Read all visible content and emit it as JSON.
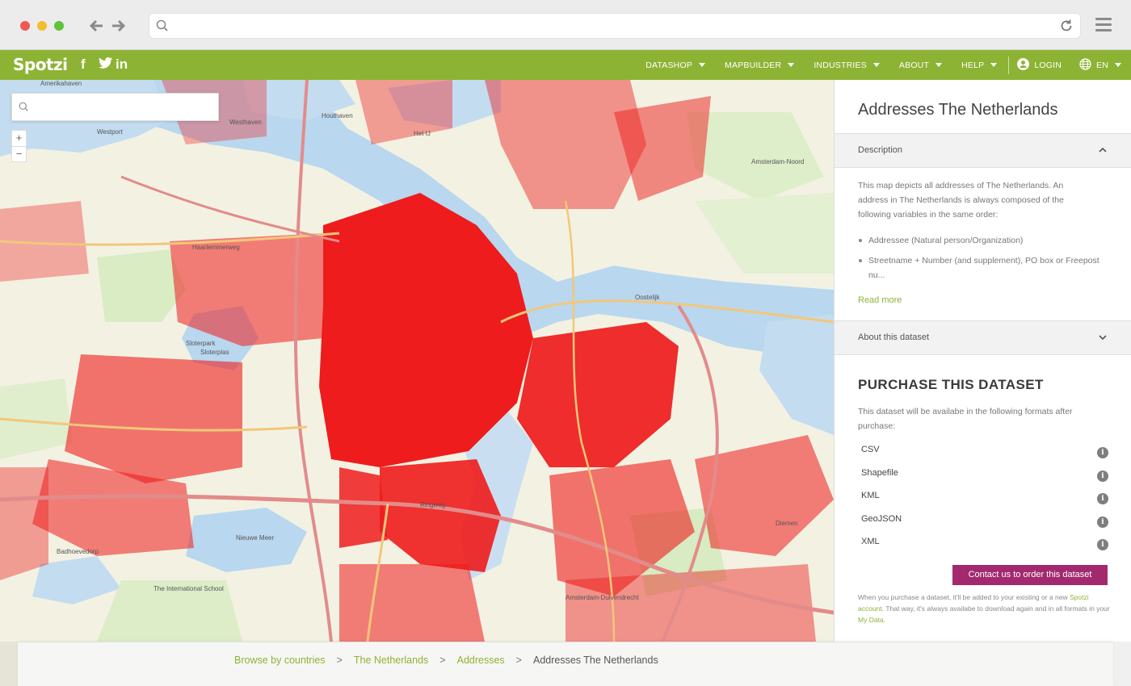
{
  "browser": {
    "back_icon": "arrow-left-icon",
    "forward_icon": "arrow-right-icon",
    "url": "",
    "reload_icon": "reload-icon",
    "menu_icon": "hamburger-icon"
  },
  "site": {
    "logo": "Spotzi",
    "social": [
      "f",
      "🐦",
      "in"
    ],
    "nav": [
      {
        "label": "DATASHOP",
        "caret": true
      },
      {
        "label": "MAPBUILDER",
        "caret": true
      },
      {
        "label": "INDUSTRIES",
        "caret": true
      },
      {
        "label": "ABOUT",
        "caret": true
      },
      {
        "label": "HELP",
        "caret": true
      }
    ],
    "login_label": "LOGIN",
    "language_label": "EN"
  },
  "map": {
    "search_placeholder": "",
    "zoom_in": "+",
    "zoom_out": "−",
    "labels": [
      {
        "text": "Amerikahaven"
      },
      {
        "text": "Westport"
      },
      {
        "text": "Westhaven"
      },
      {
        "text": "Houthaven"
      },
      {
        "text": "Het IJ"
      },
      {
        "text": "Haarlemmerweg"
      },
      {
        "text": "Sloterpark"
      },
      {
        "text": "Sloterplas"
      },
      {
        "text": "Nieuwe Meer"
      },
      {
        "text": "Badhoevedorp"
      },
      {
        "text": "Amsterdam-Noord"
      },
      {
        "text": "Oostelijk"
      },
      {
        "text": "Diemen"
      },
      {
        "text": "The International School"
      },
      {
        "text": "Ringweg"
      },
      {
        "text": "Amsterdam-Duivendrecht"
      }
    ]
  },
  "panel": {
    "title": "Addresses The Netherlands",
    "description_header": "Description",
    "description_text": "This map depicts all addresses of The Netherlands. An address in The Netherlands is always composed of the following variables in the same order:",
    "bullets": [
      "Addressee (Natural person/Organization)",
      "Streetname + Number (and supplement), PO box or Freepost nu..."
    ],
    "read_more": "Read more",
    "about_header": "About this dataset",
    "purchase_title": "PURCHASE THIS DATASET",
    "purchase_text": "This dataset will be availabe in the following formats after purchase:",
    "formats": [
      "CSV",
      "Shapefile",
      "KML",
      "GeoJSON",
      "XML"
    ],
    "contact_button": "Contact us to order this dataset",
    "fineprint_pre": "When you purchase a dataset, it'll be added to your existing or a new ",
    "fineprint_link1": "Spotzi account",
    "fineprint_mid": ". That way, it's always availabe to download again and in all formats in your ",
    "fineprint_link2": "My Data",
    "fineprint_post": "."
  },
  "breadcrumb": {
    "items": [
      "Browse by countries",
      "The Netherlands",
      "Addresses",
      "Addresses The Netherlands"
    ],
    "separator": ">"
  }
}
